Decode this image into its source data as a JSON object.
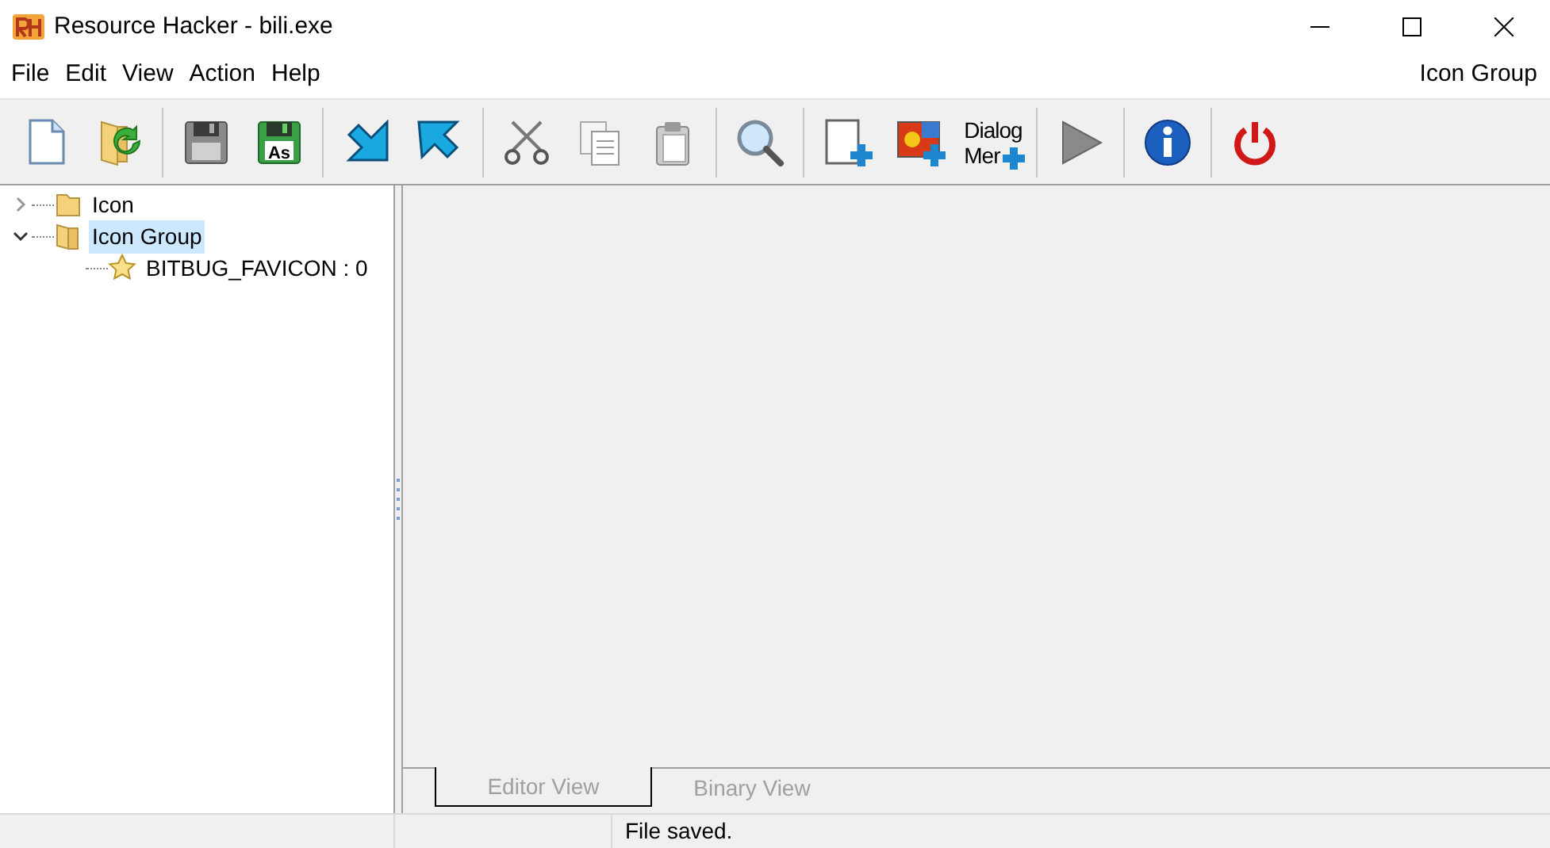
{
  "window": {
    "title": "Resource Hacker - bili.exe"
  },
  "menu": [
    "File",
    "Edit",
    "View",
    "Action",
    "Help"
  ],
  "menu_right_label": "Icon Group",
  "toolbar": [
    {
      "kind": "new"
    },
    {
      "kind": "open"
    },
    {
      "kind": "sep"
    },
    {
      "kind": "save"
    },
    {
      "kind": "saveas",
      "text": "As"
    },
    {
      "kind": "sep"
    },
    {
      "kind": "import"
    },
    {
      "kind": "export"
    },
    {
      "kind": "sep"
    },
    {
      "kind": "cut"
    },
    {
      "kind": "copy"
    },
    {
      "kind": "paste"
    },
    {
      "kind": "sep"
    },
    {
      "kind": "find"
    },
    {
      "kind": "sep"
    },
    {
      "kind": "addblank"
    },
    {
      "kind": "addimage"
    },
    {
      "kind": "dialog",
      "lines": [
        "Dialog",
        "Mer"
      ]
    },
    {
      "kind": "sep"
    },
    {
      "kind": "run"
    },
    {
      "kind": "sep"
    },
    {
      "kind": "about"
    },
    {
      "kind": "sep"
    },
    {
      "kind": "exit"
    }
  ],
  "tree": [
    {
      "label": "Icon",
      "expanded": false,
      "selected": false,
      "kind": "folder"
    },
    {
      "label": "Icon Group",
      "expanded": true,
      "selected": true,
      "kind": "folder",
      "children": [
        {
          "label": "BITBUG_FAVICON : 0",
          "selected": false,
          "kind": "star"
        }
      ]
    }
  ],
  "view_tabs": [
    {
      "label": "Editor View",
      "selected": true
    },
    {
      "label": "Binary View",
      "selected": false
    }
  ],
  "status_bar": [
    "File saved."
  ]
}
